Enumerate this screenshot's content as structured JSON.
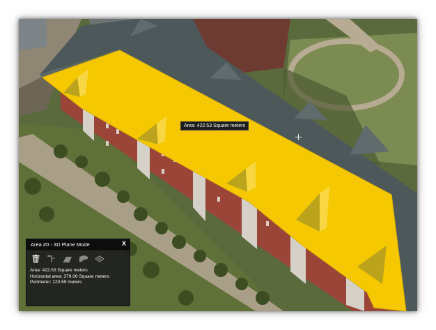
{
  "area_tooltip": "Area: 422.53 Square meters",
  "panel": {
    "title": "Area #0 - 3D Plane Mode",
    "close_label": "X",
    "tools": [
      {
        "name": "delete-icon"
      },
      {
        "name": "pin-tool-icon"
      },
      {
        "name": "plane-tool-icon"
      },
      {
        "name": "flag-tool-icon"
      },
      {
        "name": "surface-tool-icon"
      }
    ],
    "area": "Area: 422.53 Square meters",
    "horizontal_area": "Horizontal area: 379.06 Square meters",
    "perimeter": "Perimeter: 120.59 meters"
  },
  "colors": {
    "highlight": "#f5c800",
    "roof": "#4d585a",
    "brick": "#9a4538",
    "grass": "#687d44",
    "panel_bg": "#1e1e1e"
  }
}
